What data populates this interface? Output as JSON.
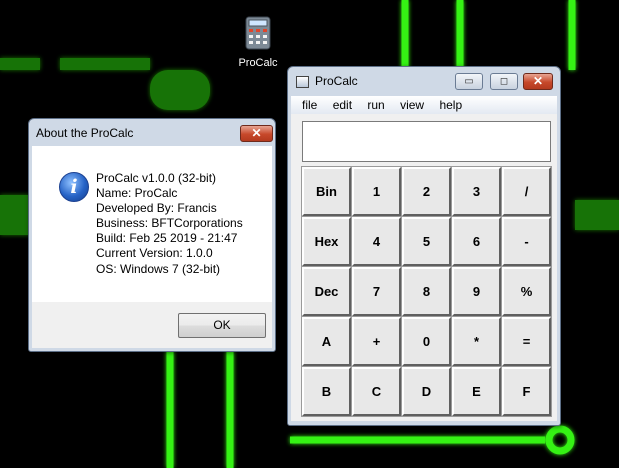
{
  "desktop": {
    "icon_label": "ProCalc",
    "wallpaper_colors": {
      "background": "#000000",
      "neon": "#39ff14"
    }
  },
  "about_dialog": {
    "title": "About the ProCalc",
    "close_glyph": "✕",
    "icon": "info-icon",
    "lines": [
      "ProCalc v1.0.0 (32-bit)",
      "Name: ProCalc",
      "Developed By: Francis",
      "Business: BFTCorporations",
      "Build: Feb 25 2019 - 21:47",
      "Current Version: 1.0.0",
      "OS: Windows 7 (32-bit)"
    ],
    "ok_label": "OK"
  },
  "calc_window": {
    "title": "ProCalc",
    "controls": {
      "minimize": "▭",
      "maximize": "◻",
      "close": "✕"
    },
    "menu": [
      "file",
      "edit",
      "run",
      "view",
      "help"
    ],
    "display_value": "",
    "keys": [
      [
        "Bin",
        "1",
        "2",
        "3",
        "/"
      ],
      [
        "Hex",
        "4",
        "5",
        "6",
        "-"
      ],
      [
        "Dec",
        "7",
        "8",
        "9",
        "%"
      ],
      [
        "A",
        "+",
        "0",
        "*",
        "="
      ],
      [
        "B",
        "C",
        "D",
        "E",
        "F"
      ]
    ]
  }
}
